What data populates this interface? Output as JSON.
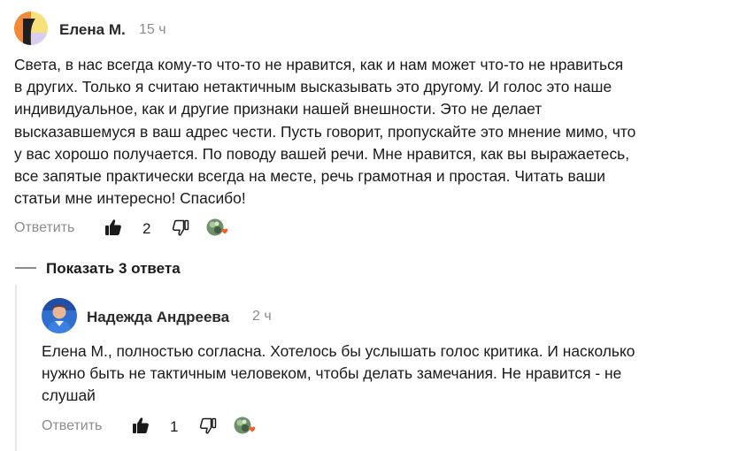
{
  "comments": [
    {
      "author": "Елена М.",
      "time": "15 ч",
      "lines": [
        "Света, в нас всегда кому-то что-то не нравится, как и нам может что-то не нравиться",
        "в других. Только я считаю нетактичным высказывать это другому. И голос это наше",
        "индивидуальное, как и другие признаки нашей внешности. Это не делает",
        "высказавшемуся в ваш адрес чести. Пусть говорит, пропускайте это мнение мимо, что",
        "у вас хорошо получается. По поводу вашей речи. Мне нравится, как вы выражаетесь,",
        "все запятые практически всегда на месте, речь грамотная и простая. Читать ваши",
        "статьи мне интересно! Спасибо!"
      ],
      "reply_label": "Ответить",
      "likes": "2"
    },
    {
      "author": "Надежда Андреева",
      "time": "2 ч",
      "lines": [
        "Елена М., полностью согласна. Хотелось бы услышать голос критика. И насколько",
        "нужно быть не тактичным человеком, чтобы делать замечания. Не нравится - не",
        "слушай"
      ],
      "reply_label": "Ответить",
      "likes": "1"
    }
  ],
  "show_replies_label": "Показать 3 ответа",
  "colors": {
    "avatar1_yellow": "#f7e17a",
    "avatar1_orange": "#f0893a",
    "avatar1_lavender": "#d9cdf2",
    "avatar2_blue": "#2f6fd0",
    "heart": "#ff5a1f"
  },
  "icons": [
    "thumbs-up-icon",
    "thumbs-down-icon",
    "reaction-icon"
  ]
}
